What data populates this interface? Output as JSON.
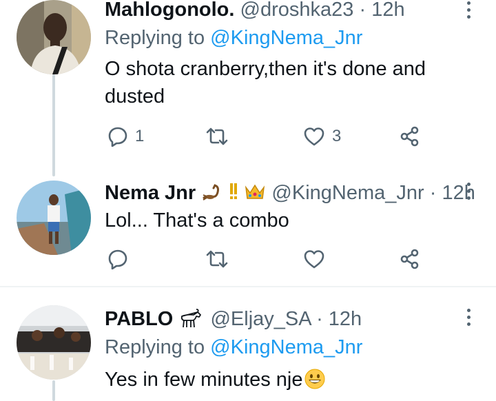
{
  "tweets": [
    {
      "display_name": "Mahlogonolo.",
      "handle": "@droshka23",
      "time": "12h",
      "replying_label": "Replying to",
      "replying_handle": "@KingNema_Jnr",
      "text": "O shota cranberry,then it's done and dusted",
      "reply_count": "1",
      "retweet_count": "",
      "like_count": "3"
    },
    {
      "display_name": "Nema Jnr",
      "name_emojis": [
        "scorpion-emoji",
        "exclamation-emoji",
        "crown-emoji"
      ],
      "handle": "@KingNema_Jnr",
      "time": "12h",
      "text": "Lol... That's a combo",
      "reply_count": "",
      "retweet_count": "",
      "like_count": ""
    },
    {
      "display_name": "PABLO",
      "name_emojis": [
        "goat-emoji"
      ],
      "handle": "@Eljay_SA",
      "time": "12h",
      "replying_label": "Replying to",
      "replying_handle": "@KingNema_Jnr",
      "text": "Yes in few minutes nje",
      "text_emoji": "grinning-face-emoji"
    }
  ],
  "icons": [
    "reply-icon",
    "retweet-icon",
    "like-icon",
    "share-icon",
    "more-icon"
  ],
  "colors": {
    "link": "#1d9bf0",
    "secondary_text": "#536471",
    "primary_text": "#0f1419",
    "thread_line": "#cfd9de",
    "divider": "#eff3f4"
  }
}
